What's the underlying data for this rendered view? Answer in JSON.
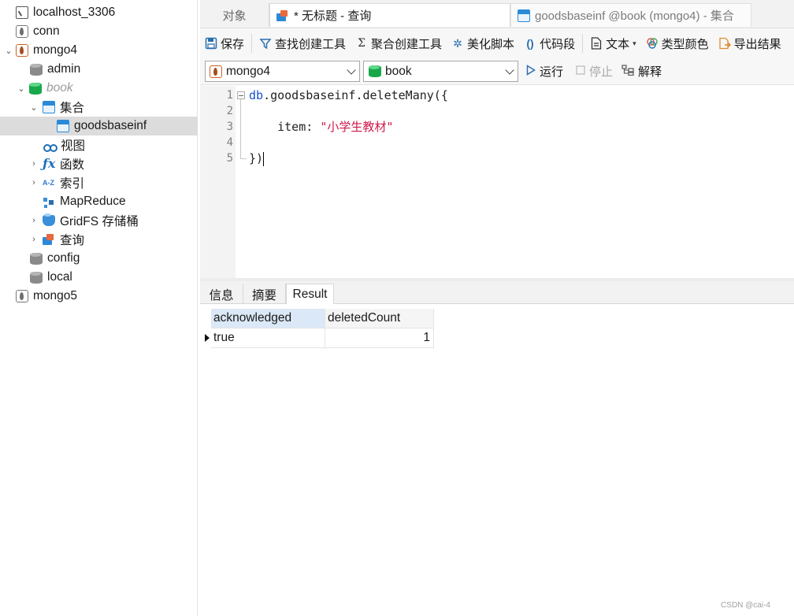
{
  "sidebar": {
    "items": [
      {
        "label": "localhost_3306",
        "icon": "server-icon"
      },
      {
        "label": "conn",
        "icon": "mongo-connection-icon"
      },
      {
        "label": "mongo4",
        "icon": "mongo-connection-icon",
        "expanded": true
      },
      {
        "label": "admin",
        "icon": "database-icon"
      },
      {
        "label": "book",
        "icon": "database-icon",
        "expanded": true
      },
      {
        "label": "集合",
        "icon": "collection-folder-icon",
        "expanded": true
      },
      {
        "label": "goodsbaseinf",
        "icon": "collection-icon",
        "selected": true
      },
      {
        "label": "视图",
        "icon": "view-icon"
      },
      {
        "label": "函数",
        "icon": "function-icon"
      },
      {
        "label": "索引",
        "icon": "index-icon"
      },
      {
        "label": "MapReduce",
        "icon": "mapreduce-icon"
      },
      {
        "label": "GridFS 存储桶",
        "icon": "gridfs-icon"
      },
      {
        "label": "查询",
        "icon": "query-icon"
      },
      {
        "label": "config",
        "icon": "database-icon"
      },
      {
        "label": "local",
        "icon": "database-icon"
      },
      {
        "label": "mongo5",
        "icon": "mongo-connection-icon"
      }
    ]
  },
  "tabs": {
    "objects": "对象",
    "active": "* 无标题 - 查询",
    "other": "goodsbaseinf @book (mongo4) - 集合"
  },
  "toolbar": {
    "save": "保存",
    "find_builder": "查找创建工具",
    "aggregate_builder": "聚合创建工具",
    "beautify": "美化脚本",
    "snippet": "代码段",
    "text": "文本",
    "type_color": "类型颜色",
    "export": "导出结果"
  },
  "connbar": {
    "connection": "mongo4",
    "database": "book",
    "run": "运行",
    "stop": "停止",
    "explain": "解释"
  },
  "editor": {
    "line_numbers": [
      "1",
      "2",
      "3",
      "4",
      "5"
    ],
    "line1_obj": "db",
    "line1_rest": ".goodsbaseinf.deleteMany({",
    "line3_key": "    item: ",
    "line3_str": "\"小学生教材\"",
    "line5": "})"
  },
  "results": {
    "tabs": [
      "信息",
      "摘要",
      "Result"
    ],
    "columns": [
      "acknowledged",
      "deletedCount"
    ],
    "rows": [
      [
        "true",
        "1"
      ]
    ]
  },
  "watermark": "CSDN @cai-4",
  "colors": {
    "accent": "#2b8ad8",
    "selected_row": "#dcdcdc",
    "string": "#d0184c",
    "mongo_active": "#c8622a"
  }
}
